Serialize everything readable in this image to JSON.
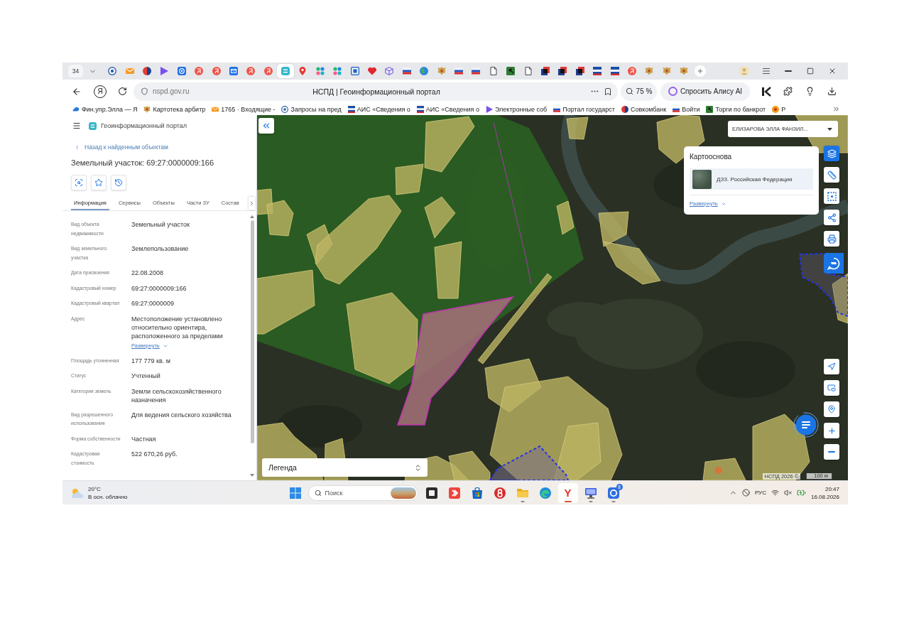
{
  "browser": {
    "tab_count": "34",
    "tabs": [
      {
        "kind": "seal",
        "selected": false
      },
      {
        "kind": "mail",
        "selected": false
      },
      {
        "kind": "bank",
        "selected": false
      },
      {
        "kind": "play",
        "selected": false
      },
      {
        "kind": "at",
        "selected": false
      },
      {
        "kind": "ya",
        "selected": false
      },
      {
        "kind": "ya",
        "selected": false
      },
      {
        "kind": "mailbox",
        "selected": false
      },
      {
        "kind": "ya",
        "selected": false
      },
      {
        "kind": "ya",
        "selected": false
      },
      {
        "kind": "portal",
        "selected": true
      },
      {
        "kind": "pin",
        "selected": false
      },
      {
        "kind": "dots",
        "selected": false
      },
      {
        "kind": "dots",
        "selected": false
      },
      {
        "kind": "frame",
        "selected": false
      },
      {
        "kind": "heart",
        "selected": false
      },
      {
        "kind": "cube",
        "selected": false
      },
      {
        "kind": "flag",
        "selected": false
      },
      {
        "kind": "globe",
        "selected": false
      },
      {
        "kind": "emblem",
        "selected": false
      },
      {
        "kind": "flag",
        "selected": false
      },
      {
        "kind": "flag",
        "selected": false
      },
      {
        "kind": "doc",
        "selected": false
      },
      {
        "kind": "gavel",
        "selected": false
      },
      {
        "kind": "doc",
        "selected": false
      },
      {
        "kind": "squares",
        "selected": false
      },
      {
        "kind": "squares",
        "selected": false
      },
      {
        "kind": "squares",
        "selected": false
      },
      {
        "kind": "stripes",
        "selected": false
      },
      {
        "kind": "stripes",
        "selected": false
      },
      {
        "kind": "ya",
        "selected": false
      },
      {
        "kind": "emblem",
        "selected": false
      },
      {
        "kind": "emblem",
        "selected": false
      },
      {
        "kind": "emblem",
        "selected": false
      }
    ],
    "home_button": "Я",
    "url": "nspd.gov.ru",
    "page_title": "НСПД | Геоинформационный портал",
    "zoom": "75 %",
    "assistant": "Спросить Алису AI",
    "bookmarks": [
      {
        "kind": "cloud",
        "label": "Фин.упр.Элла — Я"
      },
      {
        "kind": "emblem",
        "label": "Картотека арбитр"
      },
      {
        "kind": "mail",
        "label": "1765 · Входящие -"
      },
      {
        "kind": "seal",
        "label": "Запросы на пред"
      },
      {
        "kind": "stripes",
        "label": "АИС «Сведения о"
      },
      {
        "kind": "stripes",
        "label": "АИС «Сведения о"
      },
      {
        "kind": "play",
        "label": "Электронные соб"
      },
      {
        "kind": "flag",
        "label": "Портал государст"
      },
      {
        "kind": "bank",
        "label": "Совкомбанк"
      },
      {
        "kind": "flag",
        "label": "Войти"
      },
      {
        "kind": "gavel",
        "label": "Торги по банкрот"
      },
      {
        "kind": "orange",
        "label": "Р"
      }
    ]
  },
  "portal": {
    "title": "Геоинформационный портал",
    "back": "Назад к найденным объектам",
    "object": "Земельный участок: 69:27:0000009:166",
    "tabs": [
      {
        "label": "Информация",
        "selected": true
      },
      {
        "label": "Сервисы",
        "selected": false
      },
      {
        "label": "Объекты",
        "selected": false
      },
      {
        "label": "Части ЗУ",
        "selected": false
      },
      {
        "label": "Состав",
        "selected": false
      }
    ],
    "properties": [
      {
        "label": "Вид объекта недвижимости",
        "value": "Земельный участок"
      },
      {
        "label": "Вид земельного участка",
        "value": "Землепользование"
      },
      {
        "label": "Дата присвоения",
        "value": "22.08.2008"
      },
      {
        "label": "Кадастровый номер",
        "value": "69:27:0000009:166"
      },
      {
        "label": "Кадастровый квартал",
        "value": "69:27:0000009"
      },
      {
        "label": "Адрес",
        "value": "Местоположение установлено относительно ориентира, расположенного за пределами",
        "link": "Развернуть"
      },
      {
        "label": "Площадь уточненная",
        "value": "177 779 кв. м"
      },
      {
        "label": "Статус",
        "value": "Учтенный"
      },
      {
        "label": "Категория земель",
        "value": "Земли сельскохозяйственного назначения"
      },
      {
        "label": "Вид разрешенного использования",
        "value": "Для ведения сельского хозяйства"
      },
      {
        "label": "Форма собственности",
        "value": "Частная"
      },
      {
        "label": "Кадастровая стоимость",
        "value": "522 670,26 руб."
      }
    ]
  },
  "map": {
    "user": "ЕЛИЗАРОВА ЭЛЛА ФАНЗИЛ...",
    "basemap": {
      "title": "Картооснова",
      "layer": "ДЗЗ. Российская Федерация",
      "link": "Развернуть"
    },
    "tools": [
      {
        "kind": "layers",
        "selected": true
      },
      {
        "kind": "ruler",
        "selected": false
      },
      {
        "kind": "area",
        "selected": false
      },
      {
        "kind": "share",
        "selected": false
      },
      {
        "kind": "print",
        "selected": false
      }
    ],
    "legend": "Легенда",
    "attribution": "НСПД 2026 ©",
    "scale": "100 м"
  },
  "taskbar": {
    "weather": {
      "temperature": "20°C",
      "condition": "В осн. облачно"
    },
    "search": {
      "placeholder": "Поиск"
    },
    "apps": [
      {
        "kind": "taskview",
        "running": false,
        "selected": false
      },
      {
        "kind": "remote",
        "running": false,
        "selected": false
      },
      {
        "kind": "store",
        "running": false,
        "selected": false
      },
      {
        "kind": "redlogo",
        "running": false,
        "selected": false
      },
      {
        "kind": "folder",
        "running": true,
        "selected": false
      },
      {
        "kind": "edge",
        "running": false,
        "selected": false
      },
      {
        "kind": "yandex",
        "logo": "Y",
        "running": true,
        "selected": true
      },
      {
        "kind": "monitor",
        "running": true,
        "selected": false
      },
      {
        "kind": "messenger",
        "badge": "8",
        "running": true,
        "selected": false
      }
    ],
    "language": "РУС",
    "time": "20:47",
    "date": "16.08.2026"
  }
}
